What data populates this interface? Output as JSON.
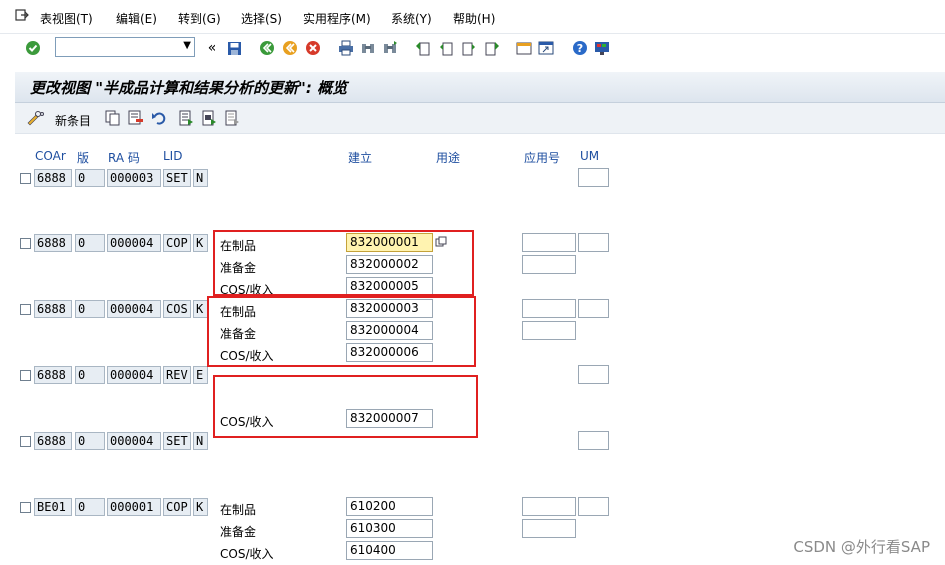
{
  "menu": {
    "items": [
      "表视图(T)",
      "编辑(E)",
      "转到(G)",
      "选择(S)",
      "实用程序(M)",
      "系统(Y)",
      "帮助(H)"
    ]
  },
  "toolbar": {
    "command_value": "",
    "icons": [
      "check-icon",
      "dropdown-icon",
      "back-double-icon",
      "save-icon",
      "back-icon",
      "exit-icon",
      "cancel-icon",
      "print-icon",
      "find-icon",
      "find-next-icon",
      "first-page-icon",
      "prev-page-icon",
      "next-page-icon",
      "last-page-icon",
      "new-session-icon",
      "shortcut-icon",
      "help-icon",
      "layout-icon"
    ]
  },
  "title": "更改视图 \"半成品计算和结果分析的更新\": 概览",
  "app_toolbar": {
    "new_entries": "新条目",
    "icons": [
      "pencil-glasses-icon",
      "copy-icon",
      "delete-icon",
      "undo-icon",
      "select-all-icon",
      "select-block-icon",
      "deselect-icon"
    ]
  },
  "columns": {
    "coar": "COAr",
    "version": "版",
    "ra_key": "RA 码",
    "lid": "LID",
    "created": "建立",
    "usage": "用途",
    "app_no": "应用号",
    "um": "UM"
  },
  "rows": [
    {
      "coar": "6888",
      "ver": "0",
      "ra": "000003",
      "lid": "SET",
      "flag": "N",
      "lines": []
    },
    {
      "coar": "6888",
      "ver": "0",
      "ra": "000004",
      "lid": "COP",
      "flag": "K",
      "lines": [
        {
          "label": "在制品",
          "value": "832000001"
        },
        {
          "label": "准备金",
          "value": "832000002"
        },
        {
          "label": "COS/收入",
          "value": "832000005"
        }
      ]
    },
    {
      "coar": "6888",
      "ver": "0",
      "ra": "000004",
      "lid": "COS",
      "flag": "K",
      "lines": [
        {
          "label": "在制品",
          "value": "832000003"
        },
        {
          "label": "准备金",
          "value": "832000004"
        },
        {
          "label": "COS/收入",
          "value": "832000006"
        }
      ]
    },
    {
      "coar": "6888",
      "ver": "0",
      "ra": "000004",
      "lid": "REV",
      "flag": "E",
      "lines": [
        {
          "label": "COS/收入",
          "value": "832000007"
        }
      ]
    },
    {
      "coar": "6888",
      "ver": "0",
      "ra": "000004",
      "lid": "SET",
      "flag": "N",
      "lines": []
    },
    {
      "coar": "BE01",
      "ver": "0",
      "ra": "000001",
      "lid": "COP",
      "flag": "K",
      "lines": [
        {
          "label": "在制品",
          "value": "610200"
        },
        {
          "label": "准备金",
          "value": "610300"
        },
        {
          "label": "COS/收入",
          "value": "610400"
        }
      ]
    }
  ],
  "watermark": "CSDN @外行看SAP"
}
